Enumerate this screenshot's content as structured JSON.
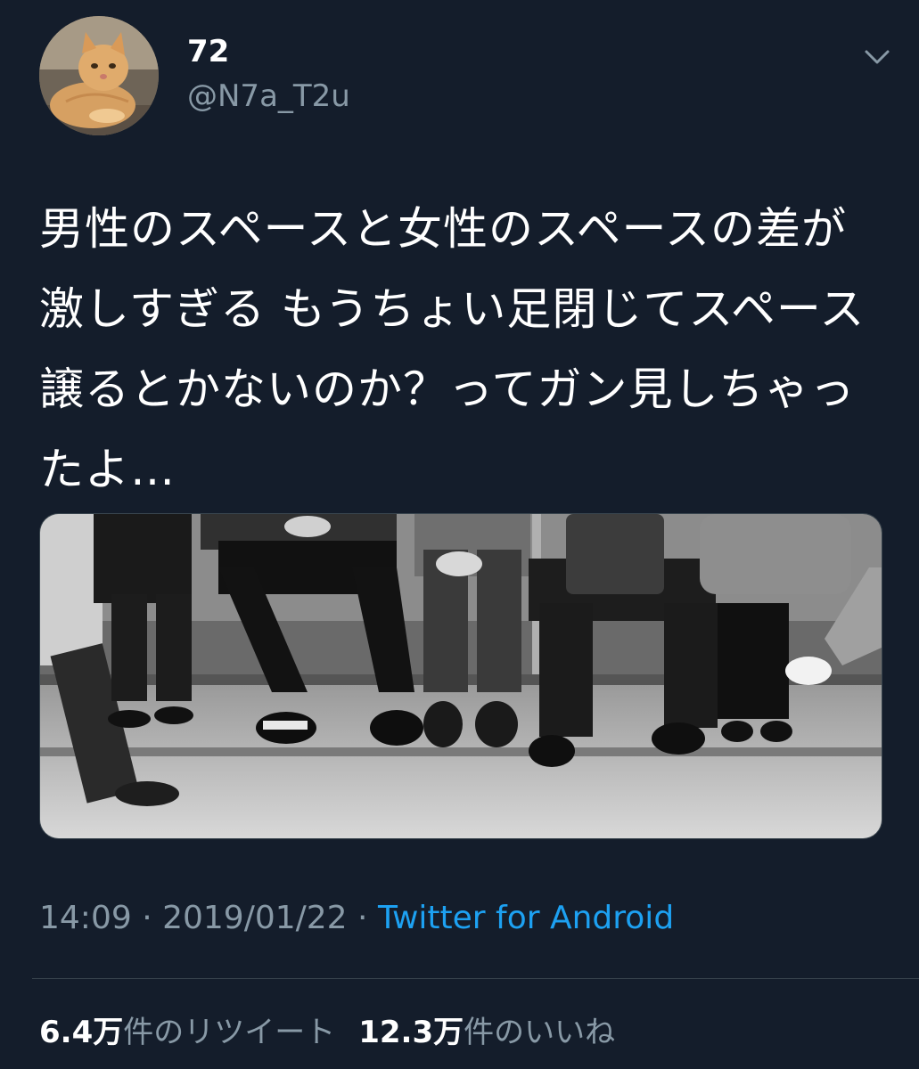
{
  "author": {
    "display_name": "72",
    "handle": "@N7a_T2u",
    "avatar_icon": "cat-avatar"
  },
  "tweet": {
    "text": "男性のスペースと女性のスペースの差が激しすぎる もうちょい足閉じてスペース譲るとかないのか？ってガン見しちゃったよ…",
    "media_icon": "photo-train-seat-legs"
  },
  "meta": {
    "time": "14:09",
    "separator": " · ",
    "date": "2019/01/22",
    "source": "Twitter for Android"
  },
  "stats": {
    "retweets_count": "6.4万",
    "retweets_label": "件のリツイート",
    "likes_count": "12.3万",
    "likes_label": "件のいいね"
  },
  "colors": {
    "background": "#141d2b",
    "secondary_text": "#8899a6",
    "link": "#1da1f2",
    "divider": "#38444d"
  }
}
